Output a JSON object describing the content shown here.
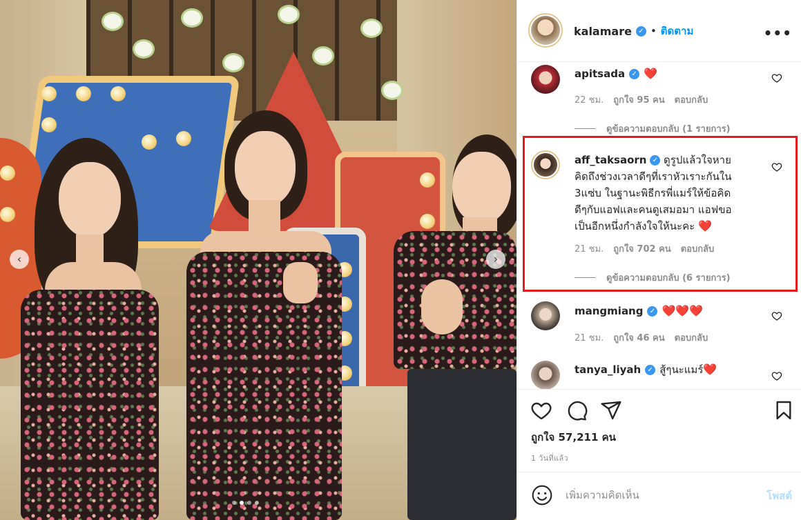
{
  "post": {
    "author": "kalamare",
    "follow_label": "ติดตาม",
    "more_icon": "more-options-icon",
    "likes_text": "ถูกใจ 57,211 คน",
    "time_ago": "1 วันที่แล้ว"
  },
  "comments": [
    {
      "user": "apitsada",
      "text": "",
      "hearts": "❤️",
      "time": "22 ชม.",
      "likes": "ถูกใจ 95 คน",
      "reply_label": "ตอบกลับ",
      "view_replies": "ดูข้อความตอบกลับ (1 รายการ)"
    },
    {
      "user": "aff_taksaorn",
      "text_lines": [
        "ดูรูปแล้วใจหาย",
        "คิดถึงช่วงเวลาดีๆที่เราหัวเราะกันใน",
        "3แซ่บ ในฐานะพิธีกรพี่แมร์ให้ข้อคิด",
        "ดีๆกับแอฟและคนดูเสมอมา แอฟขอ",
        "เป็นอีกหนึ่งกำลังใจให้นะคะ"
      ],
      "hearts": "❤️",
      "time": "21 ชม.",
      "likes": "ถูกใจ 702 คน",
      "reply_label": "ตอบกลับ",
      "view_replies": "ดูข้อความตอบกลับ (6 รายการ)"
    },
    {
      "user": "mangmiang",
      "hearts": "❤️❤️❤️",
      "time": "21 ชม.",
      "likes": "ถูกใจ 46 คน",
      "reply_label": "ตอบกลับ"
    },
    {
      "user": "tanya_liyah",
      "text": "สู้ๆนะแมร์",
      "hearts": "❤️"
    }
  ],
  "composer": {
    "placeholder": "เพิ่มความคิดเห็น",
    "post_label": "โพสต์"
  },
  "colors": {
    "accent": "#0095f6",
    "highlight_border": "#e51a1a",
    "verified": "#3897f0",
    "muted_text": "#8e8e8e"
  },
  "carousel": {
    "total_images": 4,
    "active_index": 2
  }
}
